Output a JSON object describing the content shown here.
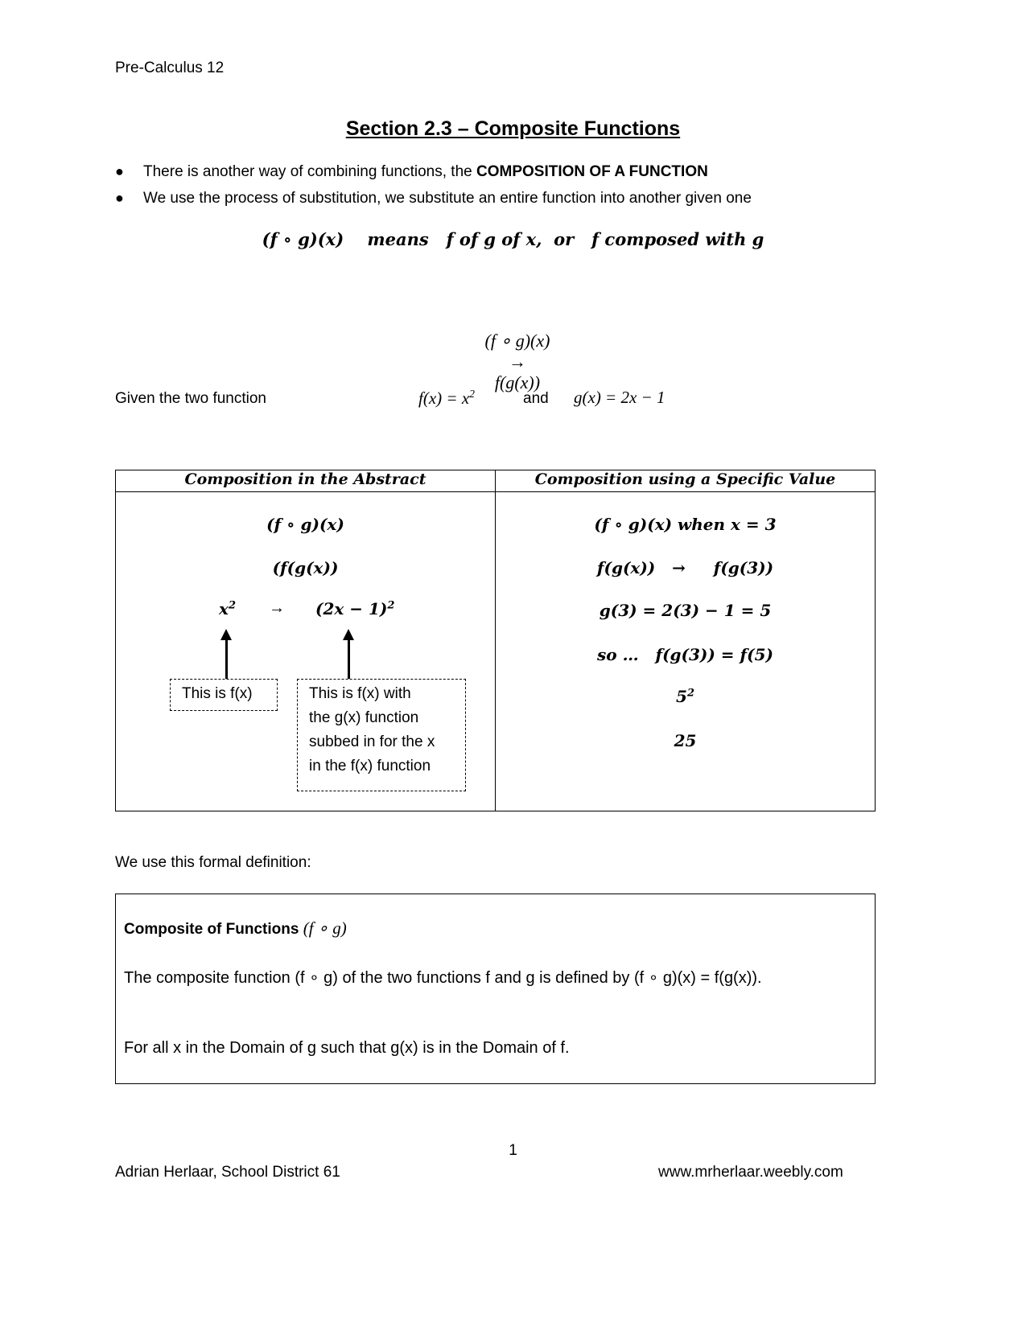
{
  "header": {
    "course": "Pre-Calculus 12"
  },
  "title": "Section 2.3 – Composite Functions",
  "bullets": [
    {
      "text": "There is another way of combining functions, the ",
      "bold": "COMPOSITION OF A FUNCTION"
    },
    {
      "text": "We use the process of substitution, we substitute an entire function into another given one",
      "bold": ""
    }
  ],
  "notation": {
    "line1": "(f ∘ g)(x)    means   f of g of x,  or   f composed with g",
    "line2_left": "(f ∘ g)(x)",
    "line2_arrow": "→",
    "line2_right": "f(g(x))"
  },
  "given": {
    "label": "Given the two function",
    "f_def": "f(x) = x",
    "f_exp": "2",
    "and": "and",
    "g_def": "g(x) = 2x − 1"
  },
  "table": {
    "headers": [
      "Composition in the Abstract",
      "Composition using a Specific Value"
    ],
    "abstract": {
      "line1": "(f ∘ g)(x)",
      "line2": "(f(g(x))",
      "line3_left": "x",
      "line3_left_exp": "2",
      "line3_arrow": "→",
      "line3_right": "(2x − 1)",
      "line3_right_exp": "2",
      "note1": "This is f(x)",
      "note2": [
        "This is f(x) with",
        "the g(x) function",
        "subbed in for the x",
        "in the f(x) function"
      ]
    },
    "specific": {
      "line1": "(f ∘ g)(x) when x = 3",
      "line2": "f(g(x))   →     f(g(3))",
      "line3": "g(3) = 2(3) − 1 = 5",
      "line4": "so …   f(g(3)) = f(5)",
      "line5_base": "5",
      "line5_exp": "2",
      "line6": "25"
    }
  },
  "formal": {
    "label": "We use this formal definition:",
    "box_title": "Composite of Functions",
    "box_title_math": "(f ∘ g)",
    "p1": "The composite function (f ∘ g)  of the two functions f and g is defined by (f ∘ g)(x) = f(g(x)).",
    "p2": "For all x in the Domain of g such that g(x) is in the Domain of f."
  },
  "footer": {
    "page": "1",
    "author": "Adrian Herlaar, School District 61",
    "website": "www.mrherlaar.weebly.com"
  }
}
